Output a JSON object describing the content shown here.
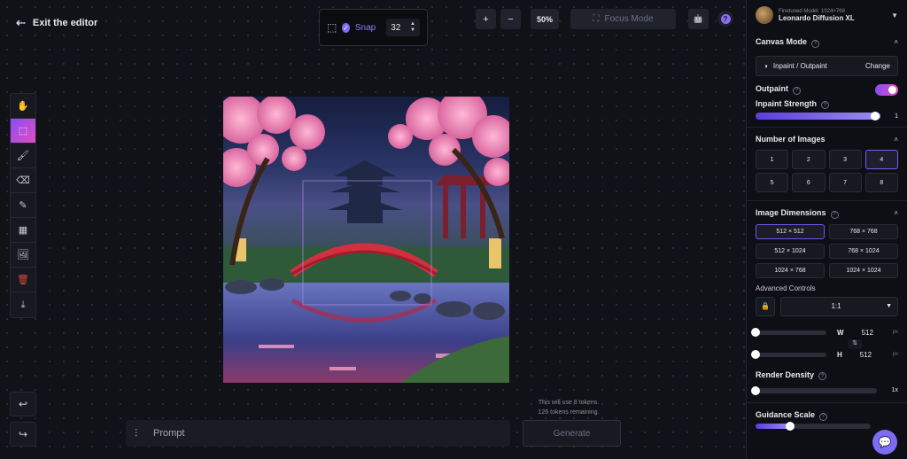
{
  "header": {
    "exit_label": "Exit the editor"
  },
  "snap": {
    "label": "Snap",
    "value": "32"
  },
  "zoom": {
    "plus": "+",
    "minus": "−",
    "level": "50%",
    "focus_label": "Focus Mode"
  },
  "toolbar": {
    "undo": "undo-icon",
    "redo": "redo-icon"
  },
  "prompt": {
    "placeholder": "Prompt",
    "generate_label": "Generate",
    "token_info_1": "This will use 8 tokens.",
    "token_info_2": "126 tokens remaining."
  },
  "panel": {
    "model": {
      "badge": "Finetuned Model",
      "size": "1024×768",
      "name": "Leonardo Diffusion XL"
    },
    "canvas_mode": {
      "title": "Canvas Mode",
      "mode": "Inpaint / Outpaint",
      "change": "Change"
    },
    "outpaint": {
      "title": "Outpaint",
      "enabled": true
    },
    "inpaint_strength": {
      "title": "Inpaint Strength",
      "value": "1",
      "fraction": 1.0
    },
    "num_images": {
      "title": "Number of Images",
      "options": [
        "1",
        "2",
        "3",
        "4",
        "5",
        "6",
        "7",
        "8"
      ],
      "selected": "4"
    },
    "dimensions": {
      "title": "Image Dimensions",
      "options": [
        "512 × 512",
        "768 × 768",
        "512 × 1024",
        "768 × 1024",
        "1024 × 768",
        "1024 × 1024"
      ],
      "selected": "512 × 512"
    },
    "advanced": {
      "title": "Advanced Controls",
      "ratio": "1:1",
      "w_label": "W",
      "w_value": "512",
      "h_label": "H",
      "h_value": "512",
      "unit": "px"
    },
    "render_density": {
      "title": "Render Density",
      "value": "1x"
    },
    "guidance": {
      "title": "Guidance Scale"
    }
  },
  "colors": {
    "accent": "#7c6cf5",
    "accent_pink": "#e14ec0",
    "bg": "#0f1117"
  }
}
